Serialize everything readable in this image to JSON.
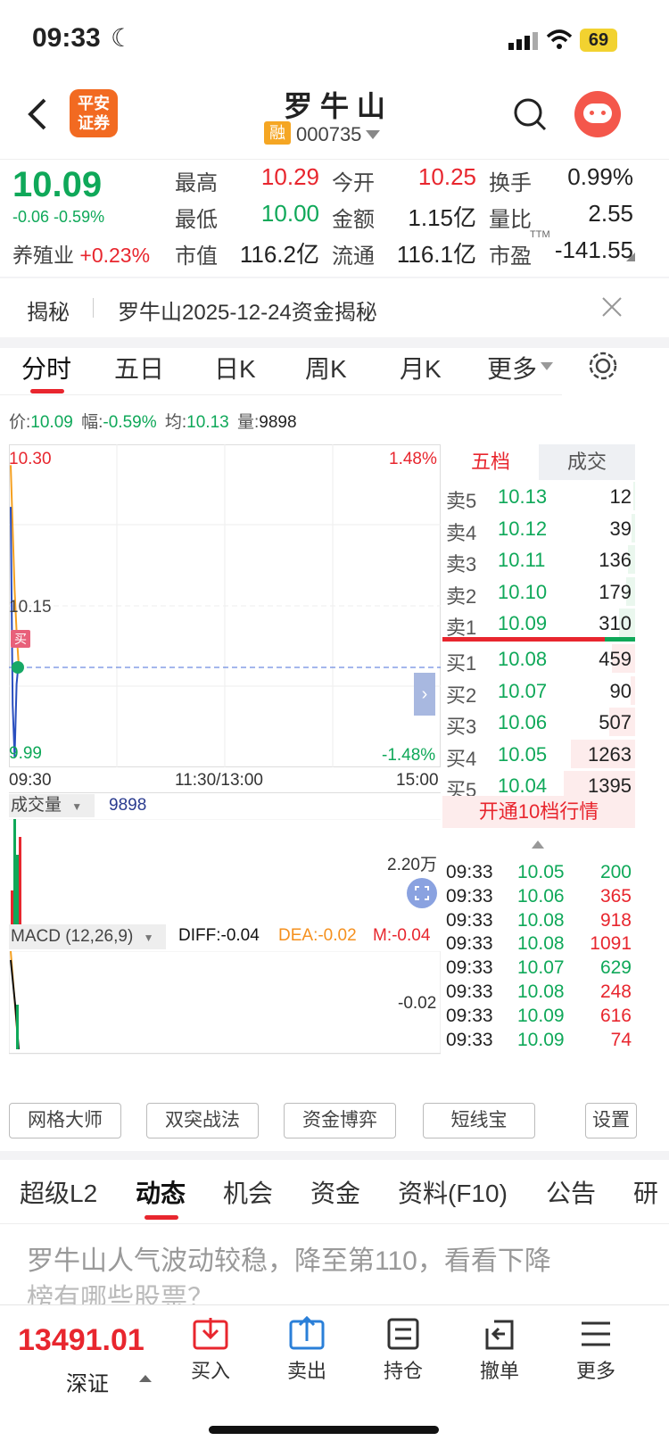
{
  "status": {
    "time": "09:33",
    "battery": "69"
  },
  "header": {
    "broker_logo": [
      "平安",
      "证券"
    ],
    "stock_name": "罗 牛 山",
    "margin_badge": "融",
    "stock_code": "000735"
  },
  "quote": {
    "price": "10.09",
    "change": "-0.06",
    "change_pct": "-0.59%",
    "sector_name": "养殖业",
    "sector_change": "+0.23%",
    "fields": [
      {
        "label": "最高",
        "value": "10.29"
      },
      {
        "label": "今开",
        "value": "10.25"
      },
      {
        "label": "换手",
        "value": "0.99%"
      },
      {
        "label": "最低",
        "value": "10.00"
      },
      {
        "label": "金额",
        "value": "1.15亿"
      },
      {
        "label": "量比",
        "value": "2.55"
      },
      {
        "label": "市值",
        "value": "116.2亿"
      },
      {
        "label": "流通",
        "value": "116.1亿"
      },
      {
        "label": "市盈",
        "value": "-141.55"
      }
    ],
    "ttm": "TTM"
  },
  "reveal": {
    "tag": "揭秘",
    "text": "罗牛山2025-12-24资金揭秘"
  },
  "chart_tabs": [
    "分时",
    "五日",
    "日K",
    "周K",
    "月K",
    "更多"
  ],
  "infobar": {
    "price_label": "价:",
    "price": "10.09",
    "pct_label": "幅:",
    "pct": "-0.59%",
    "avg_label": "均:",
    "avg": "10.13",
    "vol_label": "量:",
    "vol": "9898"
  },
  "chart_data": {
    "type": "line",
    "y_top": "10.30",
    "y_mid": "10.15",
    "y_bottom": "9.99",
    "pct_top": "1.48%",
    "pct_bottom": "-1.48%",
    "x_labels": [
      "09:30",
      "11:30/13:00",
      "15:00"
    ],
    "buy_marker": "买",
    "ylim": [
      9.99,
      10.3
    ],
    "series": [
      {
        "values": [
          10.28,
          10.22,
          10.16,
          10.12,
          10.09
        ]
      },
      {
        "values": [
          10.24,
          10.05,
          10.0,
          10.07,
          10.09
        ]
      }
    ]
  },
  "volume": {
    "label": "成交量",
    "value": "9898",
    "max": "2.20万"
  },
  "macd": {
    "label": "MACD (12,26,9)",
    "diff": "DIFF:-0.04",
    "dea": "DEA:-0.02",
    "m": "M:-0.04",
    "axis": "-0.02"
  },
  "book": {
    "tab_five": "五档",
    "tab_trades": "成交",
    "asks": [
      {
        "label": "卖5",
        "price": "10.13",
        "vol": "12",
        "fill": 0.02
      },
      {
        "label": "卖4",
        "price": "10.12",
        "vol": "39",
        "fill": 0.05
      },
      {
        "label": "卖3",
        "price": "10.11",
        "vol": "136",
        "fill": 0.1
      },
      {
        "label": "卖2",
        "price": "10.10",
        "vol": "179",
        "fill": 0.13
      },
      {
        "label": "卖1",
        "price": "10.09",
        "vol": "310",
        "fill": 0.22
      }
    ],
    "bids": [
      {
        "label": "买1",
        "price": "10.08",
        "vol": "459",
        "fill": 0.33
      },
      {
        "label": "买2",
        "price": "10.07",
        "vol": "90",
        "fill": 0.06
      },
      {
        "label": "买3",
        "price": "10.06",
        "vol": "507",
        "fill": 0.36
      },
      {
        "label": "买4",
        "price": "10.05",
        "vol": "1263",
        "fill": 0.9
      },
      {
        "label": "买5",
        "price": "10.04",
        "vol": "1395",
        "fill": 1.0
      }
    ],
    "upgrade": "开通10档行情"
  },
  "trades": [
    {
      "time": "09:33",
      "price": "10.05",
      "vol": "200",
      "color": "#0fa859"
    },
    {
      "time": "09:33",
      "price": "10.06",
      "vol": "365",
      "color": "#e8262e"
    },
    {
      "time": "09:33",
      "price": "10.08",
      "vol": "918",
      "color": "#e8262e"
    },
    {
      "time": "09:33",
      "price": "10.08",
      "vol": "1091",
      "color": "#e8262e"
    },
    {
      "time": "09:33",
      "price": "10.07",
      "vol": "629",
      "color": "#0fa859"
    },
    {
      "time": "09:33",
      "price": "10.08",
      "vol": "248",
      "color": "#e8262e"
    },
    {
      "time": "09:33",
      "price": "10.09",
      "vol": "616",
      "color": "#e8262e"
    },
    {
      "time": "09:33",
      "price": "10.09",
      "vol": "74",
      "color": "#e8262e"
    }
  ],
  "tools": [
    "网格大师",
    "双突战法",
    "资金博弈",
    "短线宝",
    "设置"
  ],
  "tabs": [
    "超级L2",
    "动态",
    "机会",
    "资金",
    "资料(F10)",
    "公告",
    "研"
  ],
  "news": {
    "text": "罗牛山人气波动较稳，降至第110，看看下降",
    "text2": "榜有哪些股票？"
  },
  "bottom": {
    "index_value": "13491.01",
    "index_name": "深证",
    "buttons": [
      "买入",
      "卖出",
      "持仓",
      "撤单",
      "更多"
    ]
  },
  "colors": {
    "red": "#e8262e",
    "green": "#0fa859",
    "blue": "#4a90e2",
    "orange": "#ff6a00"
  }
}
